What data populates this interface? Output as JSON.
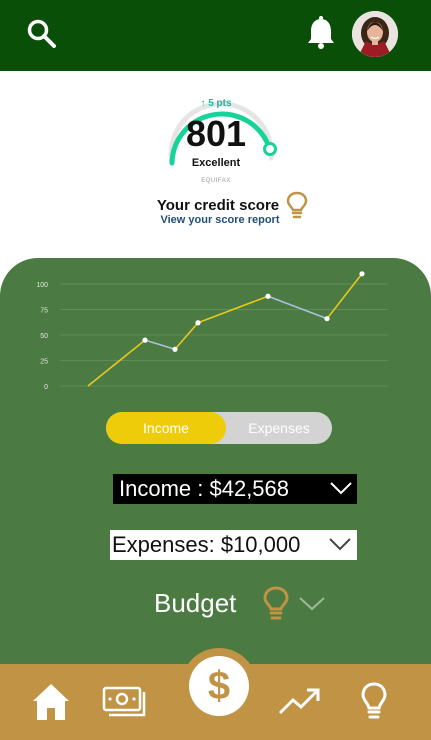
{
  "header": {
    "search_icon": "search-icon",
    "notification_icon": "bell-icon",
    "avatar_icon": "profile-avatar"
  },
  "credit_score": {
    "change": "↑ 5 pts",
    "score": "801",
    "rating": "Excellent",
    "bureau": "EQUIFAX",
    "title": "Your credit score",
    "link": "View your score report",
    "gauge_fraction": 0.8
  },
  "chart_data": {
    "type": "line",
    "x": [
      0,
      1,
      2,
      3,
      4,
      5,
      6
    ],
    "series": [
      {
        "values": [
          0,
          45,
          36,
          62,
          88,
          66,
          110
        ]
      }
    ],
    "yticks": [
      "100",
      "75",
      "50",
      "25",
      "0"
    ],
    "ylim": [
      0,
      100
    ],
    "grid": true,
    "segment_colors": [
      "#e8c81f",
      "#a9c1dc"
    ]
  },
  "toggle": {
    "income_label": "Income",
    "expenses_label": "Expenses",
    "selected": "Income"
  },
  "income": {
    "label": "Income : $42,568"
  },
  "expenses": {
    "label": "Expenses: $10,000"
  },
  "budget": {
    "label": "Budget"
  },
  "nav": {
    "items": [
      "home-icon",
      "cash-icon",
      "dollar-icon",
      "trending-icon",
      "lightbulb-icon"
    ]
  },
  "colors": {
    "header": "#0a4f08",
    "panel": "#4b7b43",
    "accent_yellow": "#efcc0a",
    "gold": "#c09345",
    "teal": "#17d39a"
  }
}
